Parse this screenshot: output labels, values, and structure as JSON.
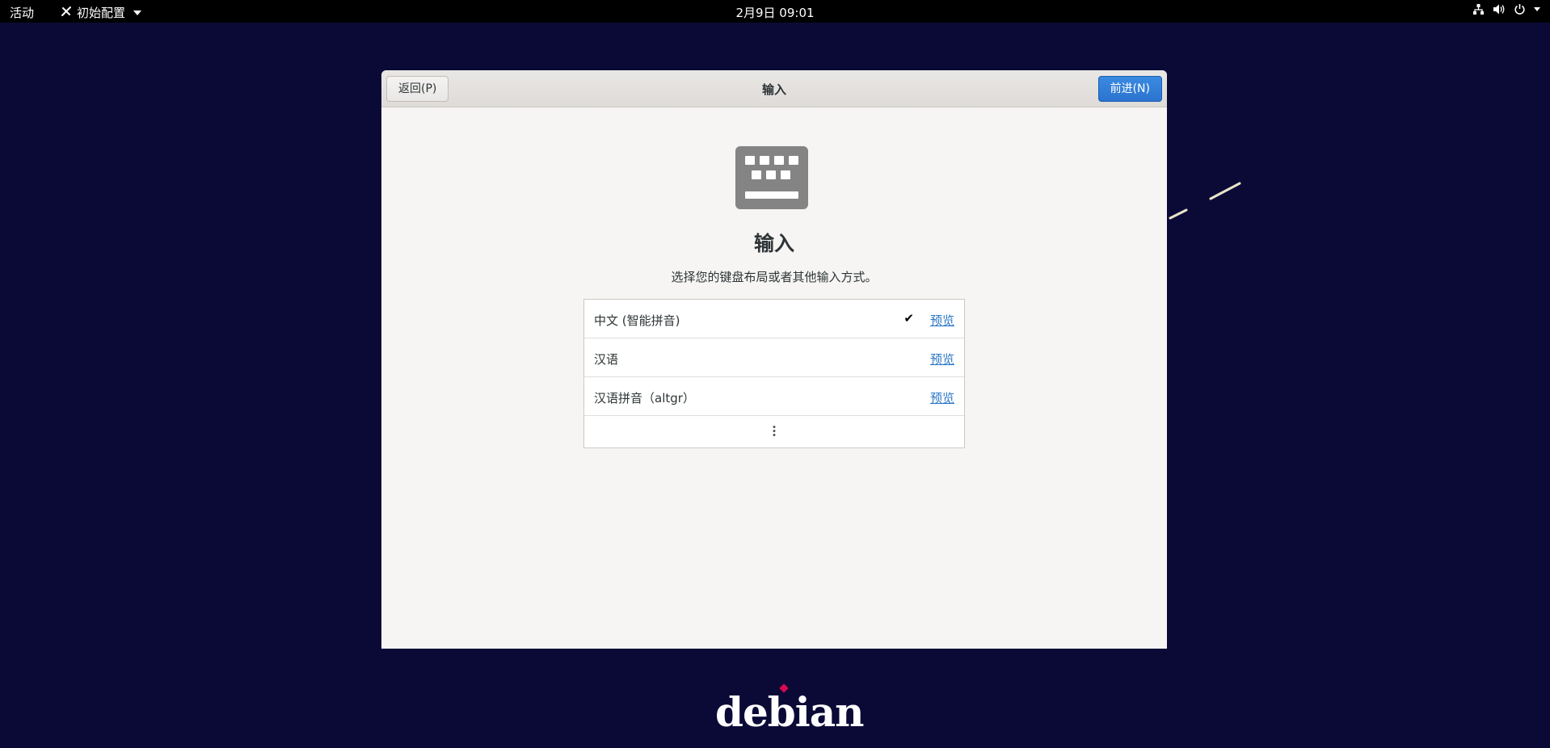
{
  "topbar": {
    "activities": "活动",
    "app_menu": "初始配置",
    "clock": "2月9日  09:01"
  },
  "window": {
    "back_label": "返回(P)",
    "title": "输入",
    "next_label": "前进(N)"
  },
  "page": {
    "heading": "输入",
    "subheading": "选择您的键盘布局或者其他输入方式。"
  },
  "inputs": [
    {
      "label": "中文 (智能拼音)",
      "selected": true,
      "preview": "预览"
    },
    {
      "label": "汉语",
      "selected": false,
      "preview": "预览"
    },
    {
      "label": "汉语拼音（altgr）",
      "selected": false,
      "preview": "预览"
    }
  ],
  "icons": {
    "selected": "checkmark-icon",
    "more": "more-vertical-icon",
    "tray": [
      "network-icon",
      "volume-icon",
      "power-icon"
    ]
  },
  "branding": {
    "logo_text": "debian"
  },
  "colors": {
    "desktop": "#0b0a37",
    "accent": "#2b74cf",
    "link": "#2a76c6",
    "logo_dot": "#d70751"
  }
}
